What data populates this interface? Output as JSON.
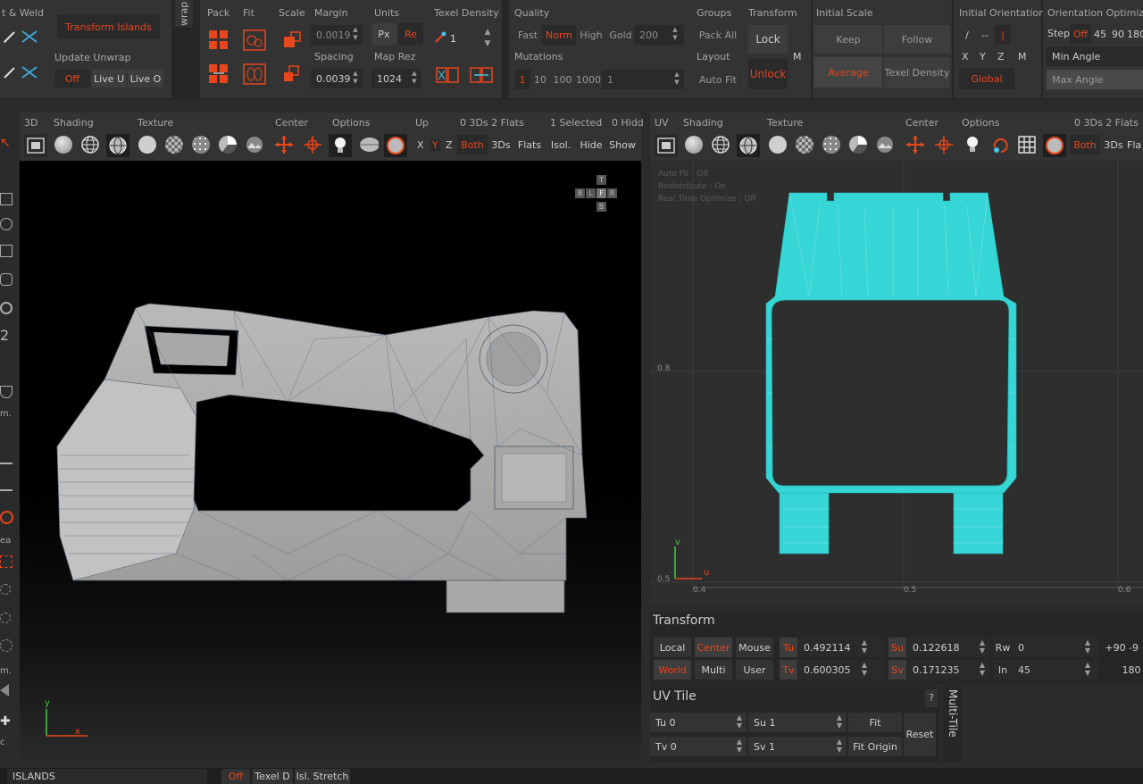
{
  "top": {
    "weld": {
      "title": "t & Weld",
      "transform_islands": "Transform Islands",
      "update_unwrap": "Update Unwrap",
      "off": "Off",
      "live_u": "Live U",
      "live_o": "Live O"
    },
    "wrap_tab": "wrap",
    "pack": {
      "pack": "Pack",
      "fit": "Fit",
      "scale": "Scale",
      "margin": "Margin",
      "margin_val": "0.0019",
      "spacing": "Spacing",
      "spacing_val": "0.0039",
      "units": "Units",
      "px": "Px",
      "re": "Re",
      "map_rez": "Map Rez",
      "map_rez_val": "1024",
      "texel_density": "Texel Density",
      "texel_val": "1"
    },
    "quality": {
      "title": "Quality",
      "fast": "Fast",
      "norm": "Norm",
      "high": "High",
      "gold": "Gold",
      "gold_val": "200",
      "mutations": "Mutations",
      "m1": "1",
      "m10": "10",
      "m100": "100",
      "m1000": "1000",
      "mval": "1"
    },
    "groups": {
      "title": "Groups",
      "pack_all": "Pack All",
      "layout": "Layout",
      "auto_fit": "Auto Fit"
    },
    "transform": {
      "title": "Transform",
      "lock": "Lock",
      "unlock": "Unlock",
      "m": "M"
    },
    "initial_scale": {
      "title": "Initial Scale",
      "keep": "Keep",
      "follow": "Follow",
      "average": "Average",
      "texel_density": "Texel Density"
    },
    "initial_orientation": {
      "title": "Initial Orientation",
      "slash": "/",
      "dashes": "--",
      "bar": "|",
      "x": "X",
      "y": "Y",
      "z": "Z",
      "m": "M",
      "global": "Global"
    },
    "orientation_opt": {
      "title": "Orientation Optimiz",
      "step": "Step",
      "off": "Off",
      "v45": "45",
      "v90": "90",
      "v180": "180",
      "min_angle": "Min Angle",
      "max_angle": "Max Angle"
    }
  },
  "left_view": {
    "tab_3d": "3D",
    "shading": "Shading",
    "texture": "Texture",
    "center": "Center",
    "options": "Options",
    "up": "Up",
    "stats": "0 3Ds 2 Flats",
    "selected": "1 Selected",
    "hidden": "0 Hidd",
    "x": "X",
    "y": "Y",
    "z": "Z",
    "both": "Both",
    "threeds": "3Ds",
    "flats": "Flats",
    "isol": "Isol.",
    "hide": "Hide",
    "show": "Show",
    "nav_cube": {
      "t": "T",
      "b": "B",
      "l": "L",
      "f": "F",
      "r": "R",
      "b2": "B"
    },
    "axis": {
      "y": "y",
      "x": "x"
    }
  },
  "right_view": {
    "tab_uv": "UV",
    "shading": "Shading",
    "texture": "Texture",
    "center": "Center",
    "options": "Options",
    "stats": "0 3Ds 2 Flats",
    "both": "Both",
    "threeds": "3Ds",
    "flats": "Fla",
    "overlay": {
      "auto_fit": "Auto Fit : Off",
      "redistribute": "Redistribute : On",
      "realtime": "Real Time Optimize : Off"
    },
    "ticks": {
      "v08": "0.8",
      "v05": "0.5",
      "u04": "0.4",
      "u05": "0.5",
      "u06": "0.6"
    },
    "axis": {
      "v": "v",
      "u": "u"
    }
  },
  "transform_panel": {
    "title": "Transform",
    "local": "Local",
    "center": "Center",
    "mouse": "Mouse",
    "world": "World",
    "multi": "Multi",
    "user": "User",
    "tu": "Tu",
    "tu_val": "0.492114",
    "tv": "Tv",
    "tv_val": "0.600305",
    "su": "Su",
    "su_val": "0.122618",
    "sv": "Sv",
    "sv_val": "0.171235",
    "rw": "Rw",
    "rw_val": "0",
    "in": "In",
    "in_val": "45",
    "p90": "+90",
    "m9": "-9",
    "v180": "180"
  },
  "uv_tile": {
    "title": "UV Tile",
    "q": "?",
    "tu": "Tu 0",
    "tv": "Tv 0",
    "su": "Su 1",
    "sv": "Sv 1",
    "fit": "Fit",
    "fit_origin": "Fit Origin",
    "reset": "Reset",
    "multi_tile": "Multi-Tile"
  },
  "status": {
    "islands": "ISLANDS",
    "off": "Off",
    "texel_d": "Texel D",
    "isl_stretch": "Isl. Stretch"
  },
  "left_tools": {
    "t2": "2",
    "m1": "m.",
    "ea": "ea",
    "m2": "m.",
    "c": "c"
  },
  "colors": {
    "accent": "#e8461c",
    "uv_island": "#36d6d6",
    "panel": "#333333",
    "field": "#2a2a2a"
  }
}
